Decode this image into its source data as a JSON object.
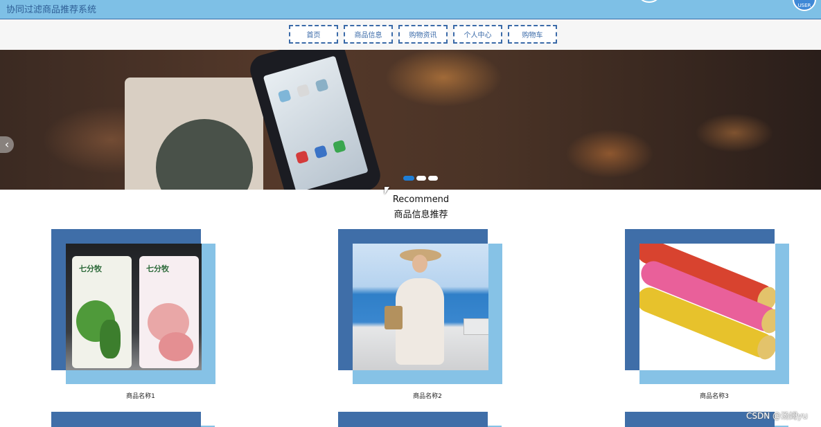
{
  "header": {
    "site_title": "协同过滤商品推荐系统",
    "avatar_text": "USER"
  },
  "nav": {
    "items": [
      {
        "label": "首页"
      },
      {
        "label": "商品信息"
      },
      {
        "label": "购物资讯"
      },
      {
        "label": "个人中心"
      },
      {
        "label": "购物车"
      }
    ]
  },
  "banner": {
    "prev_glyph": "‹",
    "slide_count": 3,
    "active_slide": 1
  },
  "section": {
    "title_en": "Recommend",
    "title_cn": "商品信息推荐"
  },
  "products": [
    {
      "name": "商品名称1",
      "mask_left": "七分牧",
      "mask_right": "七分牧"
    },
    {
      "name": "商品名称2"
    },
    {
      "name": "商品名称3"
    }
  ],
  "colors": {
    "header_bg": "#7ec0e6",
    "nav_border": "#3a6aa8",
    "card_dark": "#3f6ea8",
    "card_light": "#86c2e6",
    "active_dot": "#1f7ed6"
  },
  "watermark": "CSDN @汤姆yu"
}
